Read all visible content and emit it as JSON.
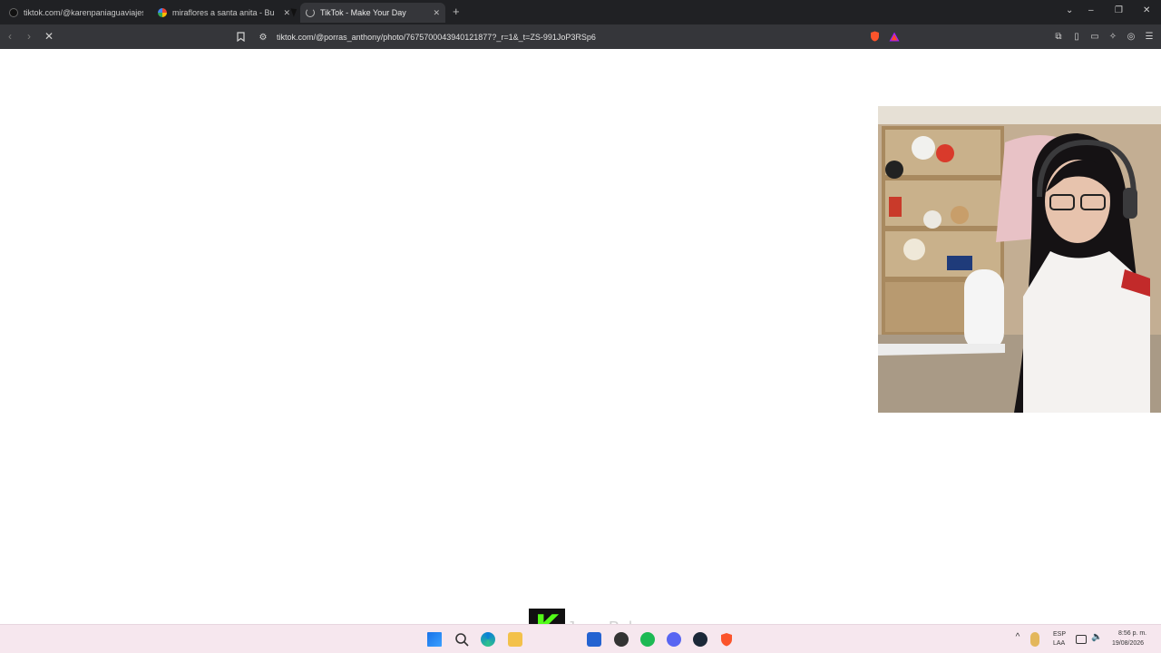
{
  "browser": {
    "tabs": [
      {
        "title": "tiktok.com/@karenpaniaguaviajes/vi",
        "icon": "tiktok-icon",
        "active": false
      },
      {
        "title": "miraflores a santa anita - Buscar",
        "icon": "google-icon",
        "active": false
      },
      {
        "title": "TikTok - Make Your Day",
        "icon": "loading-icon",
        "active": true
      }
    ],
    "new_tab_symbol": "+",
    "url": "tiktok.com/@porras_anthony/photo/7675700043940121877?_r=1&_t=ZS-991JoP3RSp6"
  },
  "colors": {
    "tabbar_bg": "#202124",
    "toolbar_bg": "#35363a",
    "taskbar_bg": "#f6e7ee",
    "brave_orange": "#fb542b"
  },
  "overlay": {
    "kick_letter": "K",
    "watermark": "JessyBaby"
  },
  "taskbar": {
    "apps": [
      "windows-start-icon",
      "search-icon",
      "edge-icon",
      "files-icon",
      "kick-icon",
      "store-icon",
      "app-icon",
      "spotify-icon",
      "discord-icon",
      "steam-icon",
      "brave-icon"
    ],
    "lang_top": "ESP",
    "lang_bottom": "LAA",
    "time": "8:56 p. m.",
    "date": "19/08/2026"
  }
}
